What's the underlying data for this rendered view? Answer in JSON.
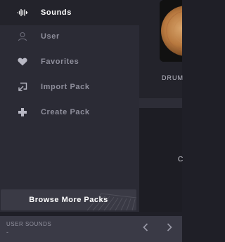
{
  "sidebar": {
    "items": [
      {
        "label": "Sounds",
        "icon": "waveform-icon",
        "active": true
      },
      {
        "label": "User",
        "icon": "user-icon",
        "active": false
      },
      {
        "label": "Favorites",
        "icon": "heart-icon",
        "active": false
      },
      {
        "label": "Import Pack",
        "icon": "import-icon",
        "active": false
      },
      {
        "label": "Create Pack",
        "icon": "plus-icon",
        "active": false
      }
    ],
    "browse_label": "Browse More Packs"
  },
  "pack_preview": {
    "label": "DRUM",
    "partial_text": "C"
  },
  "footer": {
    "section_label": "USER SOUNDS",
    "value": "-",
    "prev_icon": "chevron-left-icon",
    "next_icon": "chevron-right-icon"
  },
  "colors": {
    "accent": "#ffffff",
    "muted_text": "#8f8f9c",
    "sidebar_bg": "#2b2b35",
    "footer_bg": "#3a3a46"
  }
}
